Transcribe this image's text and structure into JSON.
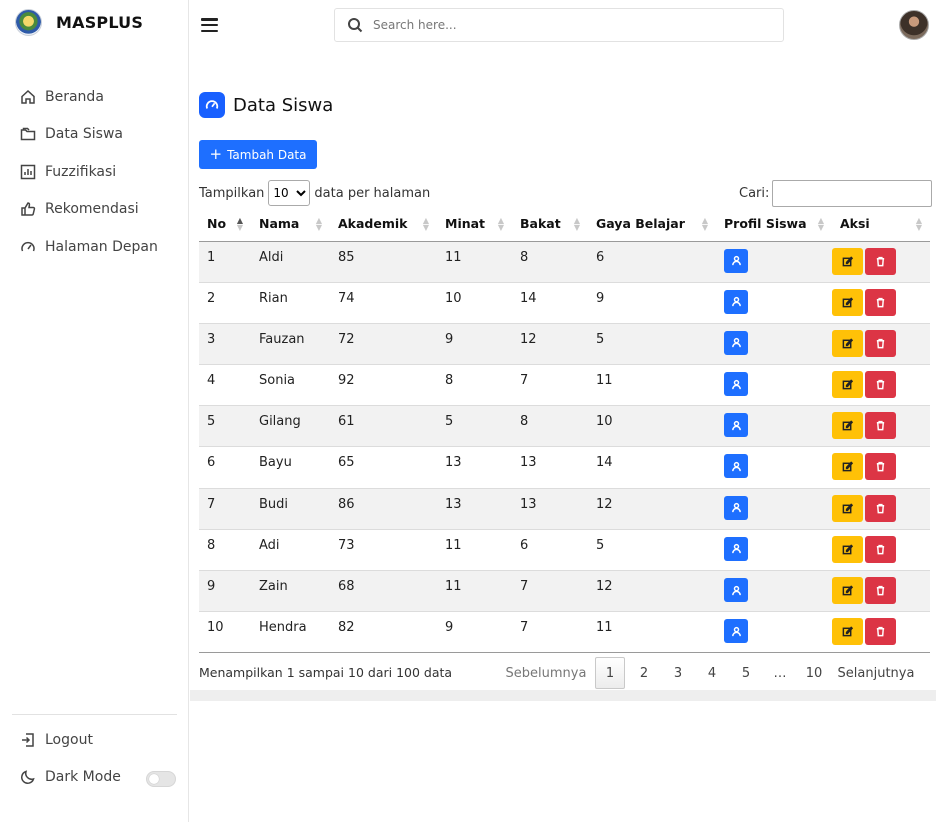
{
  "app": {
    "name": "MASPLUS"
  },
  "sidebar": {
    "items": [
      {
        "label": "Beranda",
        "icon": "home-icon"
      },
      {
        "label": "Data Siswa",
        "icon": "folder-icon"
      },
      {
        "label": "Fuzzifikasi",
        "icon": "bar-chart-icon"
      },
      {
        "label": "Rekomendasi",
        "icon": "thumbs-up-icon"
      },
      {
        "label": "Halaman Depan",
        "icon": "speedometer-icon"
      }
    ],
    "logout": "Logout",
    "dark_mode": "Dark Mode",
    "dark_mode_on": false
  },
  "topbar": {
    "search_placeholder": "Search here..."
  },
  "page": {
    "title": "Data Siswa",
    "add_button": "Tambah Data",
    "length_prefix": "Tampilkan",
    "length_value": "10",
    "length_suffix": "data per halaman",
    "search_label": "Cari:"
  },
  "table": {
    "headers": [
      "No",
      "Nama",
      "Akademik",
      "Minat",
      "Bakat",
      "Gaya Belajar",
      "Profil Siswa",
      "Aksi"
    ],
    "rows": [
      [
        "1",
        "Aldi",
        "85",
        "11",
        "8",
        "6"
      ],
      [
        "2",
        "Rian",
        "74",
        "10",
        "14",
        "9"
      ],
      [
        "3",
        "Fauzan",
        "72",
        "9",
        "12",
        "5"
      ],
      [
        "4",
        "Sonia",
        "92",
        "8",
        "7",
        "11"
      ],
      [
        "5",
        "Gilang",
        "61",
        "5",
        "8",
        "10"
      ],
      [
        "6",
        "Bayu",
        "65",
        "13",
        "13",
        "14"
      ],
      [
        "7",
        "Budi",
        "86",
        "13",
        "13",
        "12"
      ],
      [
        "8",
        "Adi",
        "73",
        "11",
        "6",
        "5"
      ],
      [
        "9",
        "Zain",
        "68",
        "11",
        "7",
        "12"
      ],
      [
        "10",
        "Hendra",
        "82",
        "9",
        "7",
        "11"
      ]
    ]
  },
  "footer": {
    "info": "Menampilkan 1 sampai 10 dari 100 data",
    "prev": "Sebelumnya",
    "pages": [
      "1",
      "2",
      "3",
      "4",
      "5",
      "…",
      "10"
    ],
    "current_page": "1",
    "next": "Selanjutnya"
  },
  "colors": {
    "primary": "#1e6fff",
    "warning": "#ffc107",
    "danger": "#dc3545"
  }
}
